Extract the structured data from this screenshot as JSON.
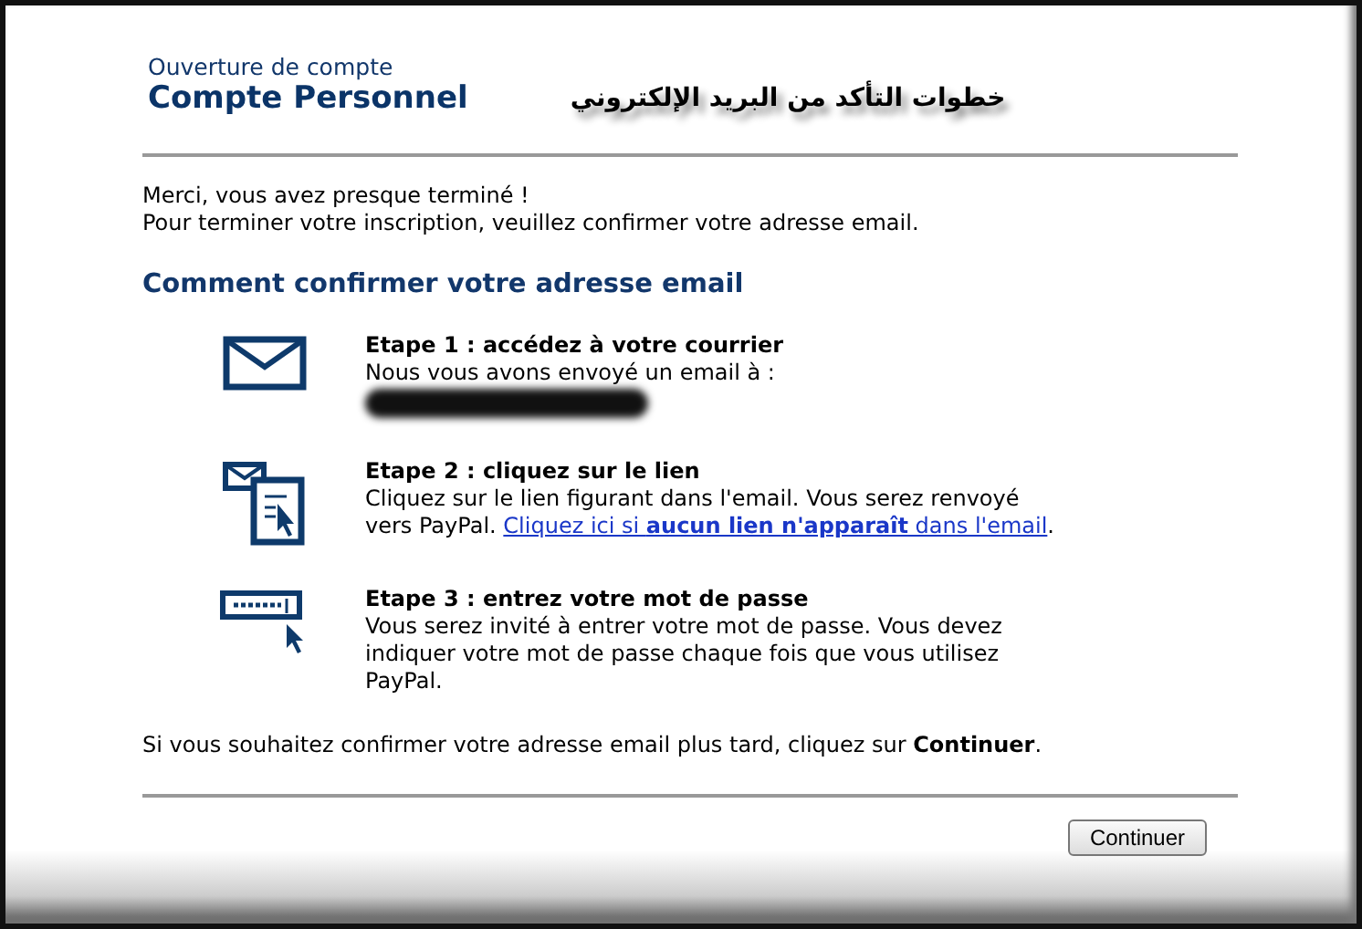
{
  "header": {
    "subtitle": "Ouverture de compte",
    "title": "Compte Personnel",
    "annotation": "خطوات التأكد من البريد الإلكتروني"
  },
  "intro": [
    "Merci, vous avez presque terminé !",
    "Pour terminer votre inscription, veuillez confirmer votre adresse email."
  ],
  "section_title": "Comment confirmer votre adresse email",
  "steps": [
    {
      "kind": "email",
      "title": "Etape 1 : accédez à votre courrier",
      "body": "Nous vous avons envoyé un email à :",
      "redacted": true
    },
    {
      "kind": "link",
      "title": "Etape 2 : cliquez sur le lien",
      "body": "Cliquez sur le lien figurant dans l'email. Vous serez renvoyé vers PayPal.",
      "link": "Cliquez ici si **aucun lien n'apparaît** dans l'email",
      "after": "."
    },
    {
      "kind": "password",
      "title": "Etape 3 : entrez votre mot de passe",
      "body": "Vous serez invité à entrer votre mot de passe. Vous devez indiquer votre mot de passe chaque fois que vous utilisez PayPal."
    }
  ],
  "footer_text": "Si vous souhaitez confirmer votre adresse email plus tard, cliquez sur **Continuer**.",
  "button": "Continuer"
}
